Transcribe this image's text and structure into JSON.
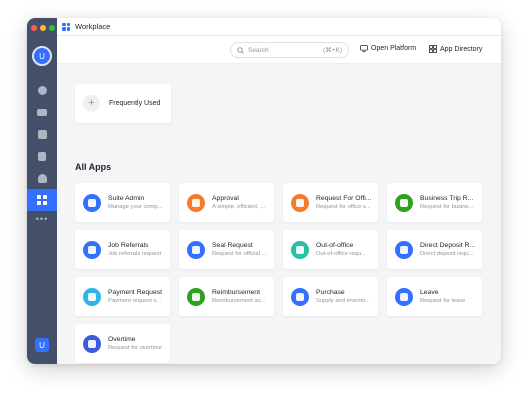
{
  "window": {
    "tab_title": "Workplace",
    "avatar_initial": "U",
    "bottom_badge": "U",
    "more_label": "•••"
  },
  "sidebar": {
    "items": [
      {
        "icon": "chat-icon"
      },
      {
        "icon": "video-icon"
      },
      {
        "icon": "calendar-icon"
      },
      {
        "icon": "docs-icon"
      },
      {
        "icon": "contacts-icon"
      },
      {
        "icon": "workplace-icon",
        "active": true
      }
    ]
  },
  "header": {
    "search_placeholder": "Search",
    "search_shortcut": "(⌘+K)",
    "open_platform": "Open Platform",
    "app_directory": "App Directory"
  },
  "frequently_used": {
    "label": "Frequently Used",
    "add_symbol": "+"
  },
  "all_apps": {
    "title": "All Apps",
    "apps": [
      {
        "name": "Suite Admin",
        "desc": "Manage your comp...",
        "color": "#3370ff",
        "icon": "admin-icon"
      },
      {
        "name": "Approval",
        "desc": "A simple, efficient, ...",
        "color": "#f57c2b",
        "icon": "approval-icon"
      },
      {
        "name": "Request For Offi...",
        "desc": "Request for office s...",
        "color": "#f57c2b",
        "icon": "office-icon"
      },
      {
        "name": "Business Trip R...",
        "desc": "Request for busine...",
        "color": "#2ea121",
        "icon": "airplane-icon"
      },
      {
        "name": "Job Referrals",
        "desc": "Job referrals request",
        "color": "#3370ff",
        "icon": "referral-icon"
      },
      {
        "name": "Seal Request",
        "desc": "Request for official ...",
        "color": "#3370ff",
        "icon": "seal-icon"
      },
      {
        "name": "Out-of-office",
        "desc": "Out-of-office requ...",
        "color": "#2bbfa5",
        "icon": "location-icon"
      },
      {
        "name": "Direct Deposit R...",
        "desc": "Direct deposit requ...",
        "color": "#3370ff",
        "icon": "deposit-icon"
      },
      {
        "name": "Payment Request",
        "desc": "Payment request s...",
        "color": "#2eb4e6",
        "icon": "payment-icon"
      },
      {
        "name": "Reimbursement",
        "desc": "Reimbursement su...",
        "color": "#2ea121",
        "icon": "reimbursement-icon"
      },
      {
        "name": "Purchase",
        "desc": "Supply and invento...",
        "color": "#3370ff",
        "icon": "cart-icon"
      },
      {
        "name": "Leave",
        "desc": "Request for leave",
        "color": "#3370ff",
        "icon": "clock-icon"
      },
      {
        "name": "Overtime",
        "desc": "Request for overtime",
        "color": "#3b5bdb",
        "icon": "overtime-icon"
      }
    ]
  }
}
